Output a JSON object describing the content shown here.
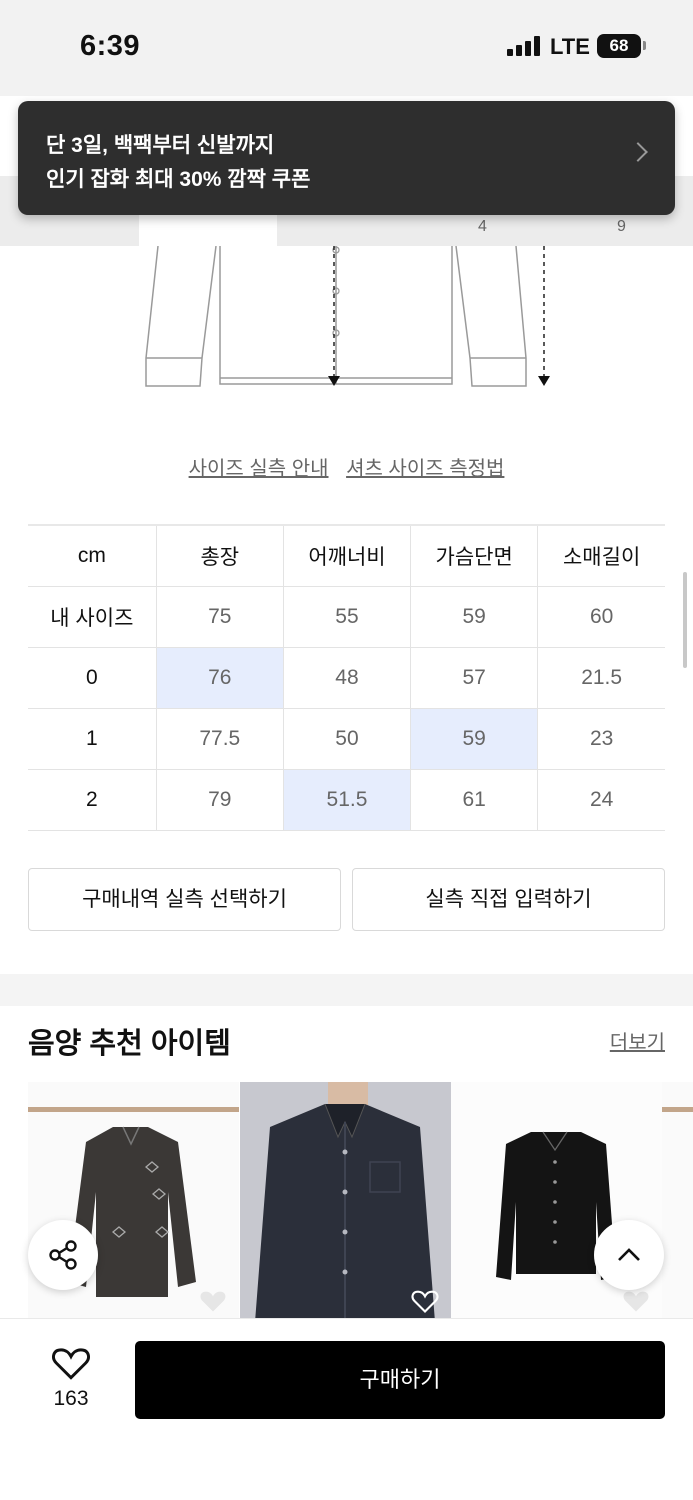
{
  "status_bar": {
    "time": "6:39",
    "network": "LTE",
    "battery": "68"
  },
  "toast": {
    "line1": "단 3일, 백팩부터 신발까지",
    "line2": "인기 잡화 최대 30% 깜짝 쿠폰"
  },
  "tab_numbers": [
    "4",
    "9"
  ],
  "guide_links": [
    "사이즈 실측 안내",
    "셔츠 사이즈 측정법"
  ],
  "size_table": {
    "columns": [
      "cm",
      "총장",
      "어깨너비",
      "가슴단면",
      "소매길이"
    ],
    "rows": [
      {
        "label": "내 사이즈",
        "values": [
          "75",
          "55",
          "59",
          "60"
        ]
      },
      {
        "label": "0",
        "values": [
          "76",
          "48",
          "57",
          "21.5"
        ]
      },
      {
        "label": "1",
        "values": [
          "77.5",
          "50",
          "59",
          "23"
        ]
      },
      {
        "label": "2",
        "values": [
          "79",
          "51.5",
          "61",
          "24"
        ]
      }
    ],
    "highlight_color": "#e6edfd"
  },
  "actions": {
    "select_purchase": "구매내역 실측 선택하기",
    "direct_input": "실측 직접 입력하기"
  },
  "recommend": {
    "title": "음양 추천 아이템",
    "more": "더보기"
  },
  "bottom_bar": {
    "like_count": "163",
    "buy_label": "구매하기"
  },
  "icons": [
    "share-icon",
    "chevron-up-icon",
    "heart-icon",
    "chevron-right-icon"
  ]
}
